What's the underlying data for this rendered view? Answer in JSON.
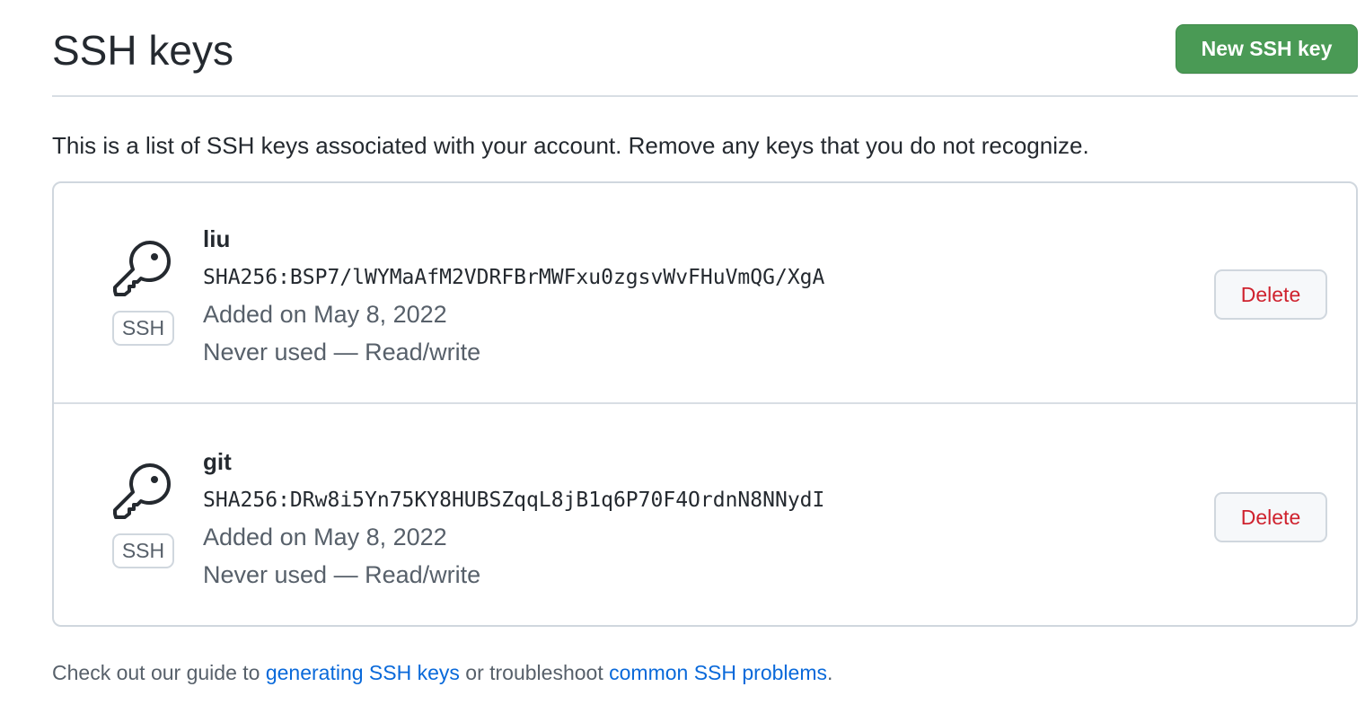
{
  "header": {
    "title": "SSH keys",
    "new_key_label": "New SSH key"
  },
  "intro": "This is a list of SSH keys associated with your account. Remove any keys that you do not recognize.",
  "keys": [
    {
      "name": "liu",
      "fingerprint": "SHA256:BSP7/lWYMaAfM2VDRFBrMWFxu0zgsvWvFHuVmQG/XgA",
      "added": "Added on May 8, 2022",
      "usage": "Never used — Read/write",
      "badge": "SSH",
      "icon": "key-icon",
      "delete_label": "Delete"
    },
    {
      "name": "git",
      "fingerprint": "SHA256:DRw8i5Yn75KY8HUBSZqqL8jB1q6P70F4OrdnN8NNydI",
      "added": "Added on May 8, 2022",
      "usage": "Never used — Read/write",
      "badge": "SSH",
      "icon": "key-icon",
      "delete_label": "Delete"
    }
  ],
  "footer": {
    "prefix": "Check out our guide to ",
    "link1": "generating SSH keys",
    "middle": " or troubleshoot ",
    "link2": "common SSH problems",
    "suffix": "."
  },
  "colors": {
    "primary_button": "#4a9a55",
    "danger": "#cf222e",
    "link": "#0969da"
  }
}
